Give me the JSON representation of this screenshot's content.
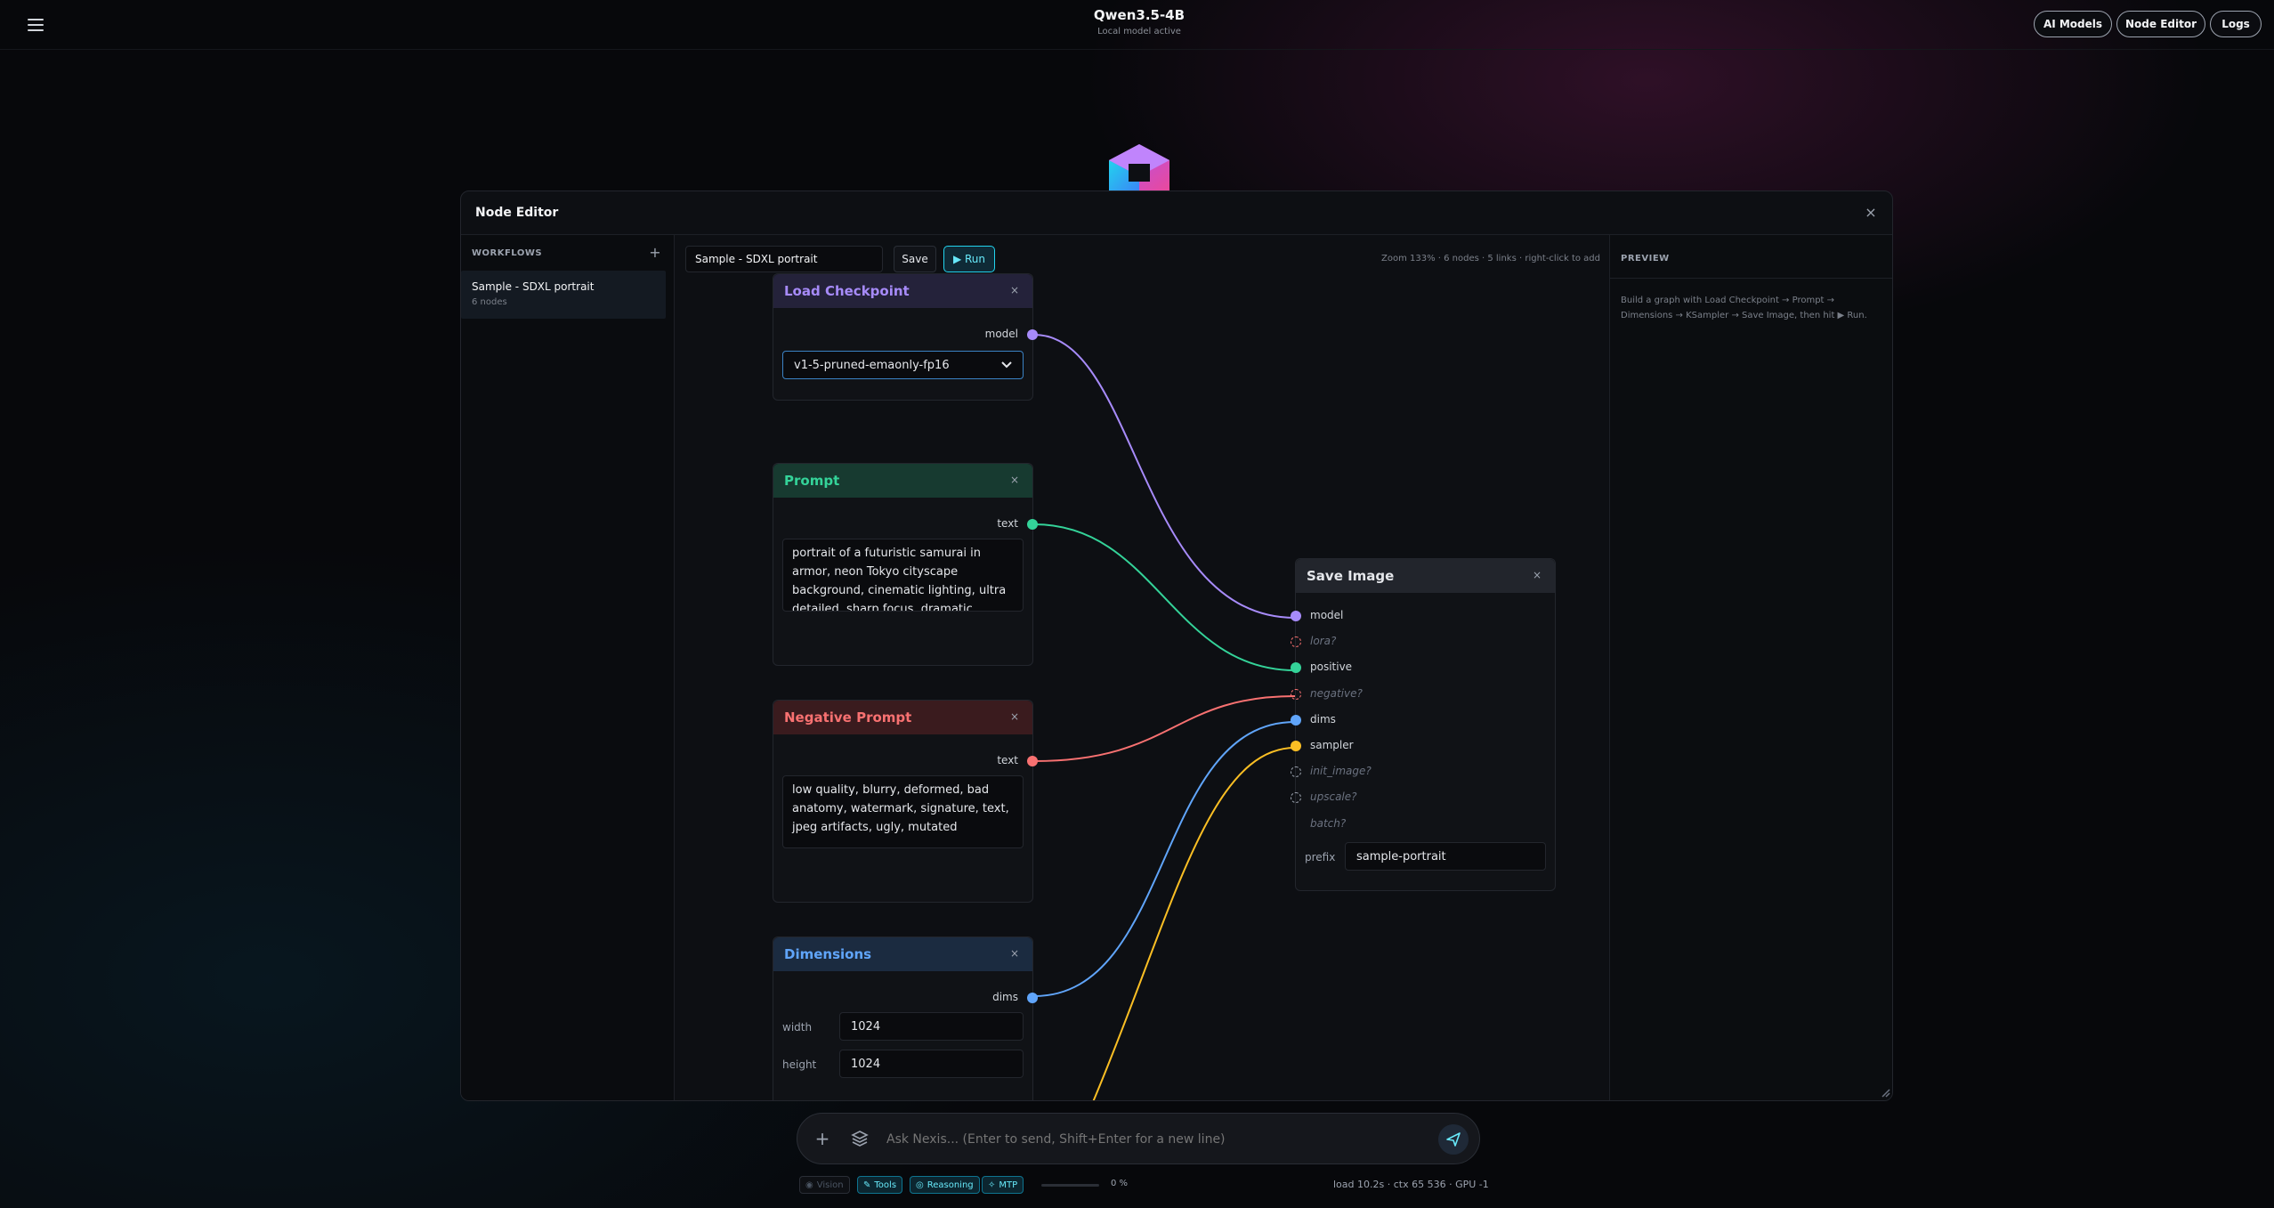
{
  "app": {
    "title": "Qwen3.5-4B",
    "subtitle": "Local model active"
  },
  "nav": {
    "ai_models": "AI Models",
    "node_editor": "Node Editor",
    "logs": "Logs"
  },
  "modal": {
    "title": "Node Editor",
    "close": "×"
  },
  "sidebar": {
    "label": "WORKFLOWS",
    "add": "+",
    "workflows": [
      {
        "name": "Sample - SDXL portrait",
        "count": "6 nodes"
      }
    ]
  },
  "toolbar": {
    "workflow_name": "Sample - SDXL portrait",
    "save": "Save",
    "run": "▶ Run",
    "status": "Zoom 133% · 6 nodes · 5 links · right-click to add"
  },
  "nodes": {
    "load_checkpoint": {
      "title": "Load Checkpoint",
      "output": "model",
      "model_select": "v1-5-pruned-emaonly-fp16"
    },
    "prompt": {
      "title": "Prompt",
      "output": "text",
      "text": "portrait of a futuristic samurai in armor, neon Tokyo cityscape background, cinematic lighting, ultra detailed, sharp focus, dramatic atmosphere"
    },
    "negative_prompt": {
      "title": "Negative Prompt",
      "output": "text",
      "text": "low quality, blurry, deformed, bad anatomy, watermark, signature, text, jpeg artifacts, ugly, mutated"
    },
    "dimensions": {
      "title": "Dimensions",
      "output": "dims",
      "width_label": "width",
      "width": "1024",
      "height_label": "height",
      "height": "1024"
    },
    "save_image": {
      "title": "Save Image",
      "inputs": [
        "model",
        "lora?",
        "positive",
        "negative?",
        "dims",
        "sampler",
        "init_image?",
        "upscale?",
        "batch?"
      ],
      "prefix_label": "prefix",
      "prefix": "sample-portrait"
    },
    "close": "×"
  },
  "colors": {
    "model": "#a78bfa",
    "positive": "#34d399",
    "negative": "#f87171",
    "dims": "#60a5fa",
    "sampler": "#fbbf24",
    "accent": "#22d3ee"
  },
  "preview": {
    "label": "PREVIEW",
    "text": "Build a graph with Load Checkpoint → Prompt → Dimensions → KSampler → Save Image, then hit ▶ Run."
  },
  "chat": {
    "placeholder": "Ask Nexis... (Enter to send, Shift+Enter for a new line)"
  },
  "footer": {
    "chips": {
      "vision": "Vision",
      "tools": "Tools",
      "reasoning": "Reasoning",
      "mtp": "MTP"
    },
    "progress": 0,
    "progress_label": "0 %",
    "stats": "load 10.2s · ctx 65 536 · GPU -1"
  }
}
